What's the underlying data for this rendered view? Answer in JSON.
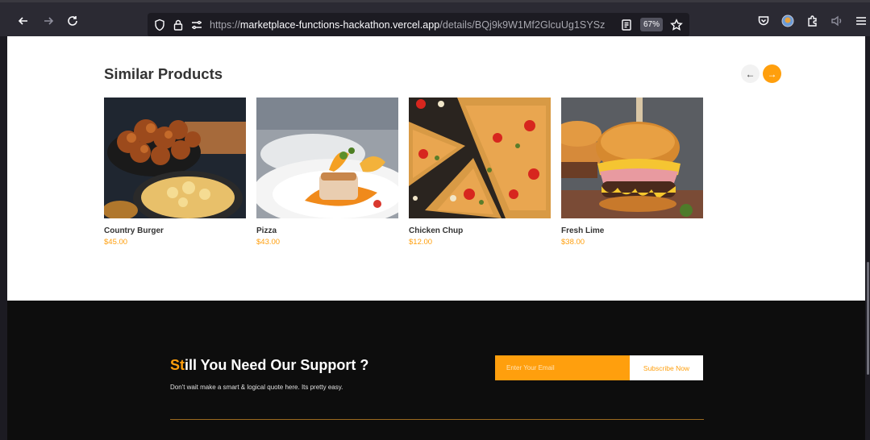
{
  "browser": {
    "url_prefix": "https://",
    "url_domain": "marketplace-functions-hackathon.vercel.app",
    "url_path": "/details/BQj9k9W1Mf2GlcuUg1SYSz",
    "zoom": "67%",
    "icons": [
      "back-icon",
      "forward-icon",
      "reload-icon",
      "shield-icon",
      "lock-icon",
      "permissions-icon",
      "reader-view-icon",
      "bookmark-star-icon",
      "pocket-icon",
      "account-icon",
      "extensions-icon",
      "speaker-icon",
      "menu-icon"
    ]
  },
  "similar": {
    "title": "Similar Products",
    "products": [
      {
        "name": "Country Burger",
        "price": "$45.00",
        "image": "fried chicken and mac and cheese"
      },
      {
        "name": "Pizza",
        "price": "$43.00",
        "image": "plated fish dish"
      },
      {
        "name": "Chicken Chup",
        "price": "$12.00",
        "image": "sliced pizza"
      },
      {
        "name": "Fresh Lime",
        "price": "$38.00",
        "image": "cheeseburger"
      }
    ]
  },
  "footer": {
    "title_highlight": "St",
    "title_rest": "ill You Need Our Support ?",
    "subtitle": "Don't wait make a smart & logical quote here. Its pretty easy.",
    "email_placeholder": "Enter Your Email",
    "subscribe_label": "Subscribe Now"
  },
  "colors": {
    "accent": "#ff9f0d",
    "footer_bg": "#0d0d0d",
    "toolbar_bg": "#2b2a33"
  }
}
